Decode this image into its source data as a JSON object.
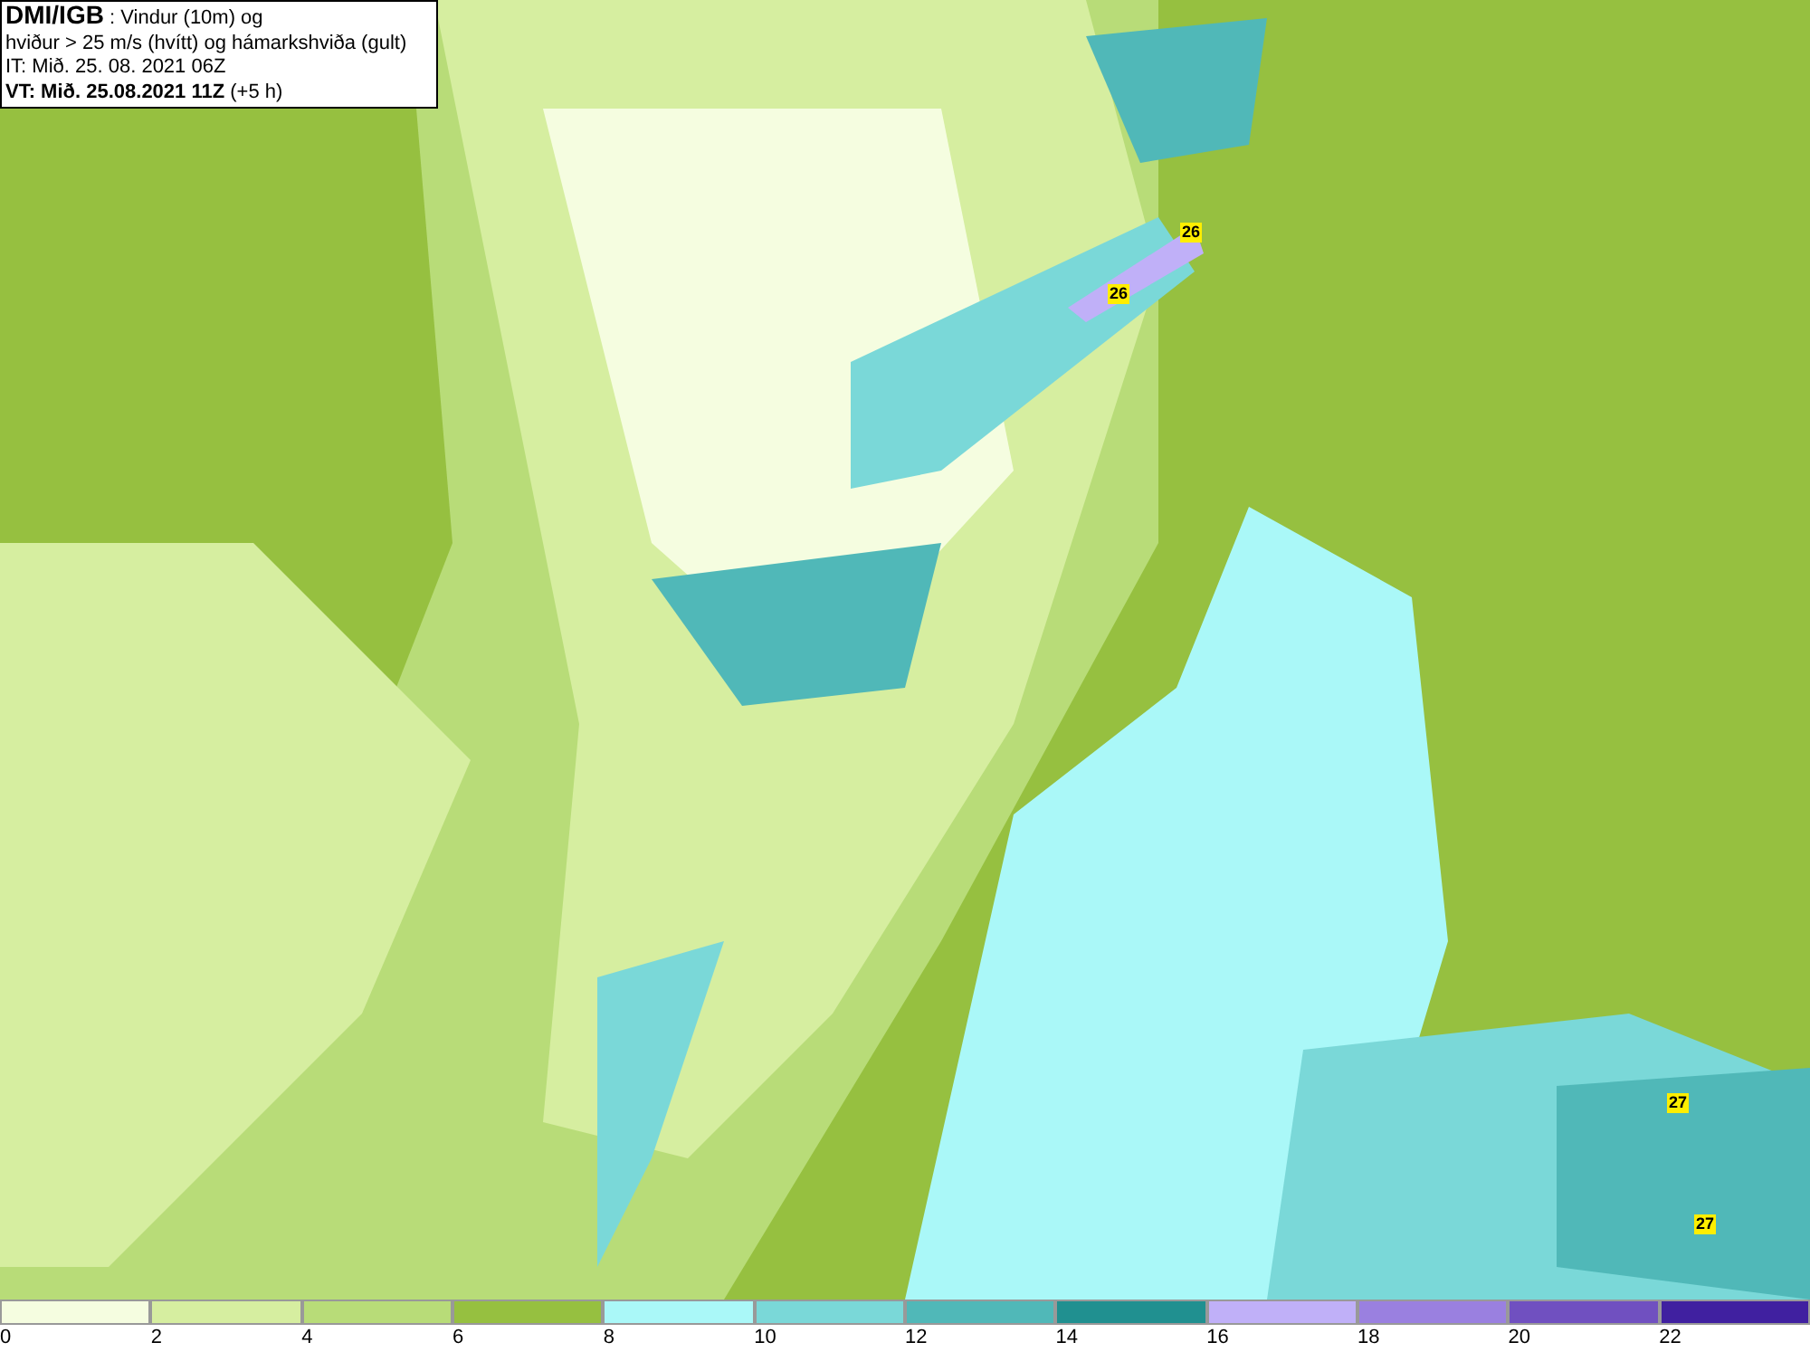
{
  "info_box": {
    "title": "**DMI/IGB** : Vindur (10m) og",
    "description": "hviður > 25 m/s (hvítt) og hámarkshviða (gult)",
    "issued": "IT: Mið. 25. 08. 2021 06Z",
    "valid": "**VT: Mið. 25.08.2021 11Z** (+5 h)"
  },
  "gust_labels": [
    {
      "value": "26"
    },
    {
      "value": "26"
    },
    {
      "value": "27"
    },
    {
      "value": "27"
    }
  ],
  "legend": {
    "bins": [
      {
        "color": "#f5fde0"
      },
      {
        "color": "#d6eea0"
      },
      {
        "color": "#b8dc78"
      },
      {
        "color": "#96c040"
      },
      {
        "color": "#aaf8f8"
      },
      {
        "color": "#7ad8d8"
      },
      {
        "color": "#50b8b8"
      },
      {
        "color": "#209090"
      },
      {
        "color": "#c0b0f8"
      },
      {
        "color": "#9a80e0"
      },
      {
        "color": "#7050c0"
      },
      {
        "color": "#4020a0"
      }
    ],
    "labels": [
      "0",
      "2",
      "4",
      "6",
      "8",
      "10",
      "12",
      "14",
      "16",
      "18",
      "20",
      "22"
    ]
  }
}
